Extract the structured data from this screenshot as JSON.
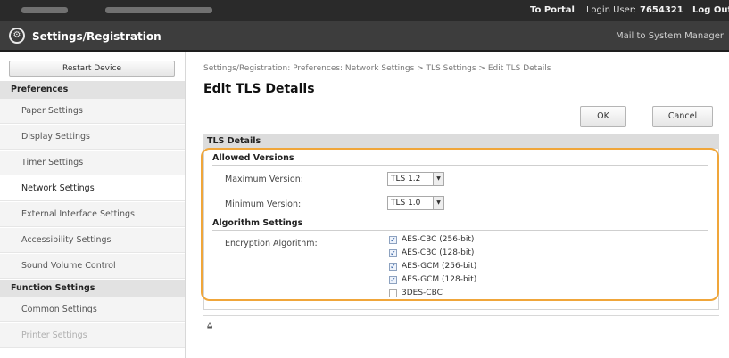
{
  "topbar": {
    "portal_link": "To Portal",
    "login_label": "Login User:",
    "login_user": "7654321",
    "logout_link": "Log Out"
  },
  "titlebar": {
    "title": "Settings/Registration",
    "mail_link": "Mail to System Manager",
    "icon": "settings-gear-icon"
  },
  "sidebar": {
    "restart_button": "Restart Device",
    "preferences_header": "Preferences",
    "preference_items": [
      {
        "label": "Paper Settings"
      },
      {
        "label": "Display Settings"
      },
      {
        "label": "Timer Settings"
      },
      {
        "label": "Network Settings"
      },
      {
        "label": "External Interface Settings"
      },
      {
        "label": "Accessibility Settings"
      },
      {
        "label": "Sound Volume Control"
      }
    ],
    "function_header": "Function Settings",
    "function_items": [
      {
        "label": "Common Settings"
      },
      {
        "label": "Printer Settings"
      }
    ],
    "active_item": "Network Settings"
  },
  "main": {
    "breadcrumb": "Settings/Registration: Preferences: Network Settings > TLS Settings > Edit TLS Details",
    "page_title": "Edit TLS Details",
    "ok_button": "OK",
    "cancel_button": "Cancel",
    "section_title": "TLS Details",
    "allowed_versions": {
      "heading": "Allowed Versions",
      "max_label": "Maximum Version:",
      "max_value": "TLS 1.2",
      "min_label": "Minimum Version:",
      "min_value": "TLS 1.0"
    },
    "algorithm_settings": {
      "heading": "Algorithm Settings",
      "encryption_label": "Encryption Algorithm:",
      "algorithms": [
        {
          "label": "AES-CBC (256-bit)",
          "checked": true
        },
        {
          "label": "AES-CBC (128-bit)",
          "checked": true
        },
        {
          "label": "AES-GCM (256-bit)",
          "checked": true
        },
        {
          "label": "AES-GCM (128-bit)",
          "checked": true
        },
        {
          "label": "3DES-CBC",
          "checked": false
        }
      ]
    },
    "highlight_color": "#f0a63a",
    "back_to_top_icon": "back-to-top-icon"
  }
}
